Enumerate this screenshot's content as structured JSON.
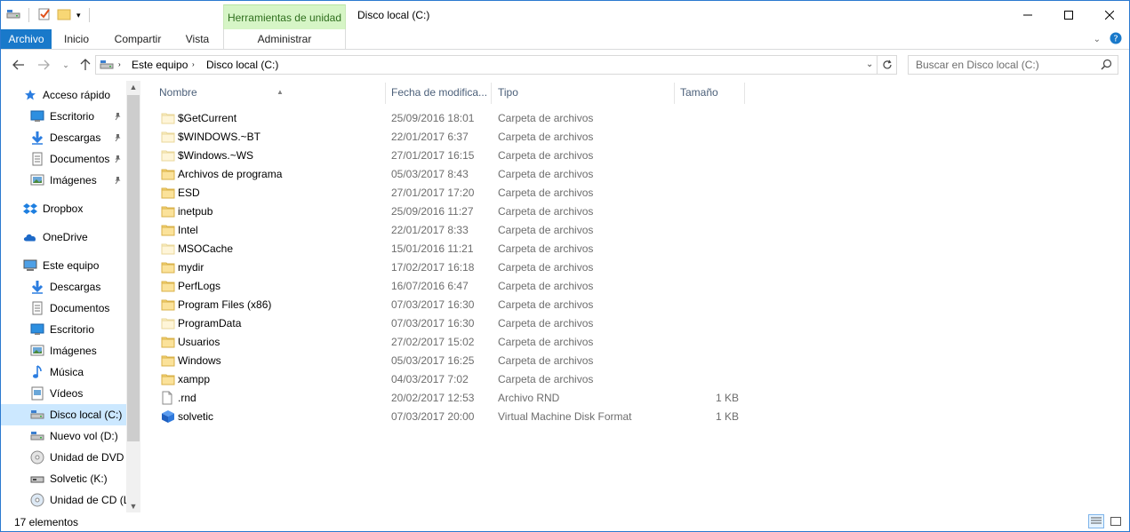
{
  "window": {
    "title": "Disco local (C:)",
    "tools_context": "Herramientas de unidad"
  },
  "ribbon": {
    "tabs": [
      "Archivo",
      "Inicio",
      "Compartir",
      "Vista",
      "Administrar"
    ]
  },
  "address": {
    "crumbs": [
      "Este equipo",
      "Disco local (C:)"
    ],
    "search_placeholder": "Buscar en Disco local (C:)"
  },
  "nav": {
    "items": [
      {
        "label": "Acceso rápido",
        "icon": "star-icon",
        "pinned": false,
        "indent": 1
      },
      {
        "label": "Escritorio",
        "icon": "desktop-icon",
        "pinned": true,
        "indent": 2
      },
      {
        "label": "Descargas",
        "icon": "download-icon",
        "pinned": true,
        "indent": 2
      },
      {
        "label": "Documentos",
        "icon": "document-icon",
        "pinned": true,
        "indent": 2
      },
      {
        "label": "Imágenes",
        "icon": "pictures-icon",
        "pinned": true,
        "indent": 2
      },
      {
        "label": "Dropbox",
        "icon": "dropbox-icon",
        "pinned": false,
        "indent": 1
      },
      {
        "label": "OneDrive",
        "icon": "onedrive-icon",
        "pinned": false,
        "indent": 1
      },
      {
        "label": "Este equipo",
        "icon": "computer-icon",
        "pinned": false,
        "indent": 1
      },
      {
        "label": "Descargas",
        "icon": "download-icon",
        "pinned": false,
        "indent": 2
      },
      {
        "label": "Documentos",
        "icon": "document-icon",
        "pinned": false,
        "indent": 2
      },
      {
        "label": "Escritorio",
        "icon": "desktop-icon",
        "pinned": false,
        "indent": 2
      },
      {
        "label": "Imágenes",
        "icon": "pictures-icon",
        "pinned": false,
        "indent": 2
      },
      {
        "label": "Música",
        "icon": "music-icon",
        "pinned": false,
        "indent": 2
      },
      {
        "label": "Vídeos",
        "icon": "video-icon",
        "pinned": false,
        "indent": 2
      },
      {
        "label": "Disco local (C:)",
        "icon": "drive-icon",
        "pinned": false,
        "indent": 2,
        "selected": true
      },
      {
        "label": "Nuevo vol (D:)",
        "icon": "drive-icon",
        "pinned": false,
        "indent": 2
      },
      {
        "label": "Unidad de DVD R",
        "icon": "dvd-icon",
        "pinned": false,
        "indent": 2
      },
      {
        "label": "Solvetic (K:)",
        "icon": "usb-drive-icon",
        "pinned": false,
        "indent": 2
      },
      {
        "label": "Unidad de CD (L",
        "icon": "cd-icon",
        "pinned": false,
        "indent": 2
      }
    ]
  },
  "columns": [
    "Nombre",
    "Fecha de modifica...",
    "Tipo",
    "Tamaño"
  ],
  "files": [
    {
      "name": "$GetCurrent",
      "date": "25/09/2016 18:01",
      "type": "Carpeta de archivos",
      "size": "",
      "icon": "folder-hidden-icon"
    },
    {
      "name": "$WINDOWS.~BT",
      "date": "22/01/2017 6:37",
      "type": "Carpeta de archivos",
      "size": "",
      "icon": "folder-hidden-icon"
    },
    {
      "name": "$Windows.~WS",
      "date": "27/01/2017 16:15",
      "type": "Carpeta de archivos",
      "size": "",
      "icon": "folder-hidden-icon"
    },
    {
      "name": "Archivos de programa",
      "date": "05/03/2017 8:43",
      "type": "Carpeta de archivos",
      "size": "",
      "icon": "folder-icon"
    },
    {
      "name": "ESD",
      "date": "27/01/2017 17:20",
      "type": "Carpeta de archivos",
      "size": "",
      "icon": "folder-icon"
    },
    {
      "name": "inetpub",
      "date": "25/09/2016 11:27",
      "type": "Carpeta de archivos",
      "size": "",
      "icon": "folder-icon"
    },
    {
      "name": "Intel",
      "date": "22/01/2017 8:33",
      "type": "Carpeta de archivos",
      "size": "",
      "icon": "folder-icon"
    },
    {
      "name": "MSOCache",
      "date": "15/01/2016 11:21",
      "type": "Carpeta de archivos",
      "size": "",
      "icon": "folder-hidden-icon"
    },
    {
      "name": "mydir",
      "date": "17/02/2017 16:18",
      "type": "Carpeta de archivos",
      "size": "",
      "icon": "folder-icon"
    },
    {
      "name": "PerfLogs",
      "date": "16/07/2016 6:47",
      "type": "Carpeta de archivos",
      "size": "",
      "icon": "folder-icon"
    },
    {
      "name": "Program Files (x86)",
      "date": "07/03/2017 16:30",
      "type": "Carpeta de archivos",
      "size": "",
      "icon": "folder-icon"
    },
    {
      "name": "ProgramData",
      "date": "07/03/2017 16:30",
      "type": "Carpeta de archivos",
      "size": "",
      "icon": "folder-hidden-icon"
    },
    {
      "name": "Usuarios",
      "date": "27/02/2017 15:02",
      "type": "Carpeta de archivos",
      "size": "",
      "icon": "folder-icon"
    },
    {
      "name": "Windows",
      "date": "05/03/2017 16:25",
      "type": "Carpeta de archivos",
      "size": "",
      "icon": "folder-icon"
    },
    {
      "name": "xampp",
      "date": "04/03/2017 7:02",
      "type": "Carpeta de archivos",
      "size": "",
      "icon": "folder-icon"
    },
    {
      "name": ".rnd",
      "date": "20/02/2017 12:53",
      "type": "Archivo RND",
      "size": "1 KB",
      "icon": "file-icon"
    },
    {
      "name": "solvetic",
      "date": "07/03/2017 20:00",
      "type": "Virtual Machine Disk Format",
      "size": "1 KB",
      "icon": "vmdk-cube-icon"
    }
  ],
  "status": {
    "count": "17 elementos"
  },
  "colors": {
    "accent": "#1979ca",
    "selection": "#cce8ff",
    "tools_bg": "#d6f5c6",
    "folder": "#f8d775"
  }
}
